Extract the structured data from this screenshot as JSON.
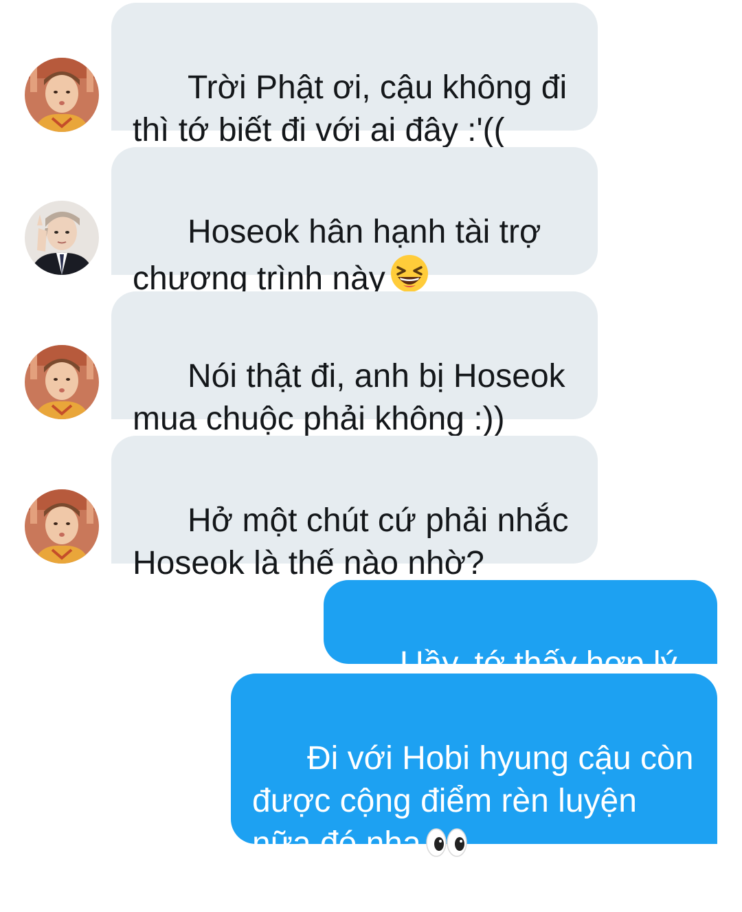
{
  "conversation": {
    "messages": [
      {
        "direction": "incoming",
        "avatar": "avatar-orange-shirt-person",
        "text": "Trời Phật ơi, cậu không đi\nthì tớ biết đi với ai đây :'(("
      },
      {
        "direction": "incoming",
        "avatar": "avatar-suit-person",
        "text": "Hoseok hân hạnh tài trợ\nchương trình này",
        "emoji": "laughing-squint-emoji"
      },
      {
        "direction": "incoming",
        "avatar": "avatar-orange-shirt-person",
        "text": "Nói thật đi, anh bị Hoseok\nmua chuộc phải không :))"
      },
      {
        "direction": "incoming",
        "avatar": "avatar-orange-shirt-person",
        "text": "Hở một chút cứ phải nhắc\nHoseok là thế nào nhờ?"
      },
      {
        "direction": "outgoing",
        "text": "Uầy, tớ thấy hợp lý mà"
      },
      {
        "direction": "outgoing",
        "text": "Đi với Hobi hyung cậu còn\nđược cộng điểm rèn luyện\nnữa đó nha",
        "emoji": "eyes-emoji"
      }
    ],
    "colors": {
      "incoming_bubble": "#e6ecf0",
      "incoming_text": "#14171a",
      "outgoing_bubble": "#1da1f2",
      "outgoing_text": "#ffffff"
    }
  }
}
